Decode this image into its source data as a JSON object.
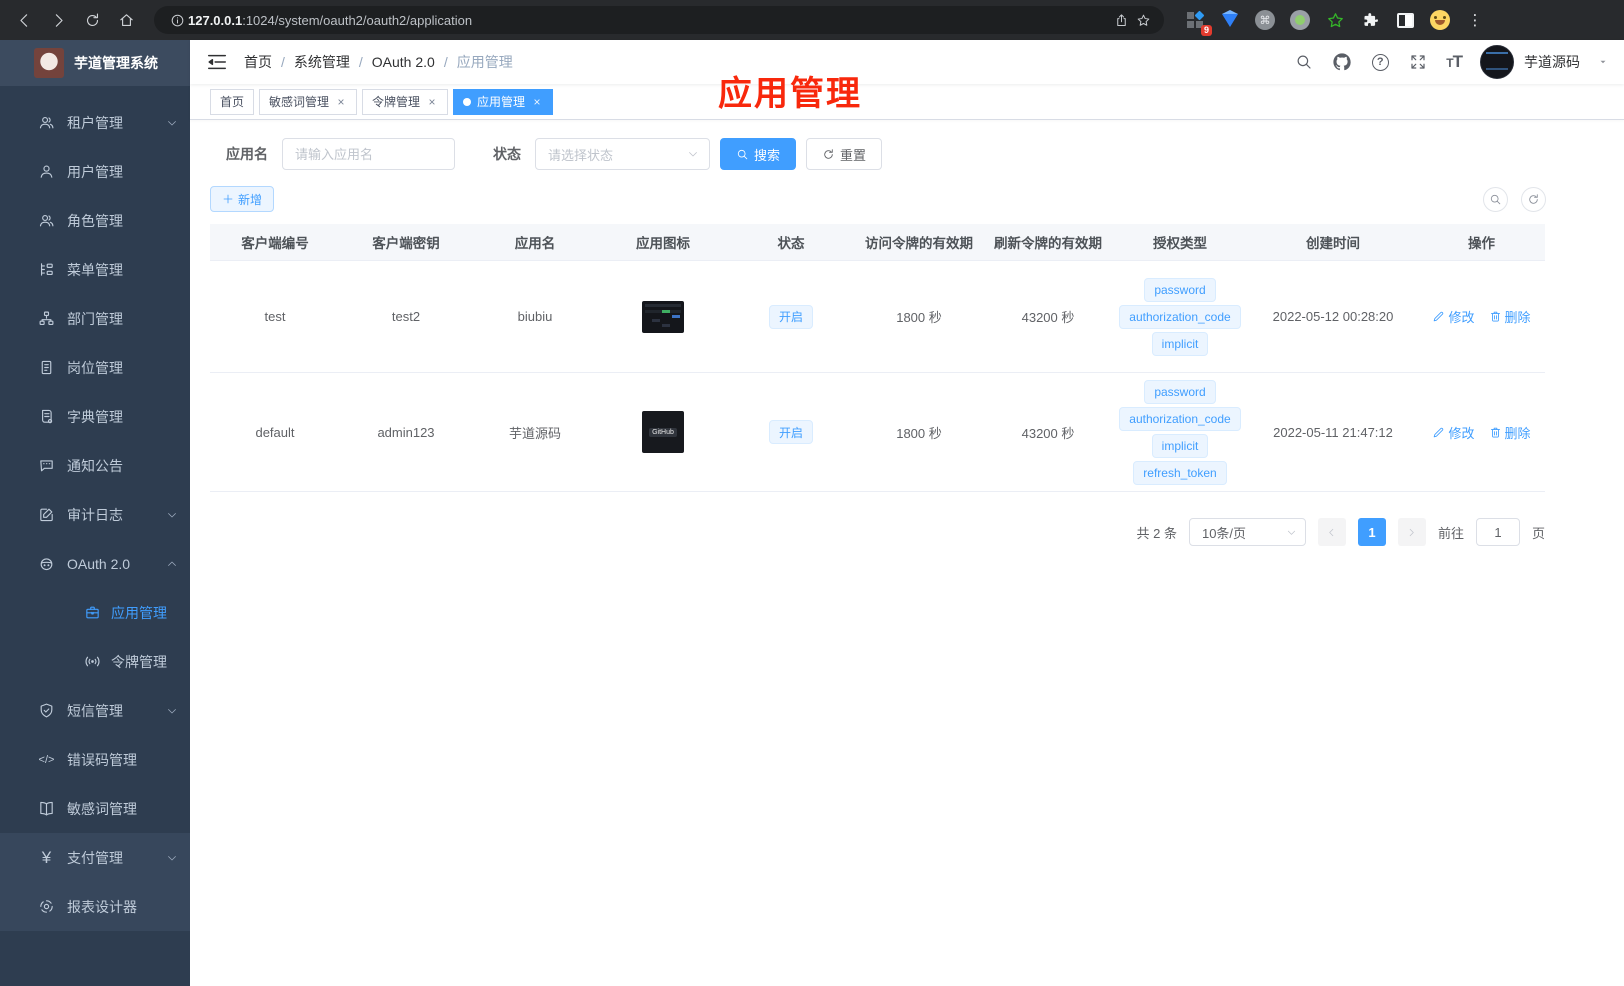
{
  "browser": {
    "url_host": "127.0.0.1",
    "url_path": ":1024/system/oauth2/oauth2/application",
    "ext_badge": "9"
  },
  "glyphs": {
    "question": "?",
    "kebab": "⋮",
    "command": "⌘",
    "yen": "¥",
    "code": "</>",
    "t_small": "T",
    "t_big": "T"
  },
  "sidebar": {
    "title": "芋道管理系统",
    "items": [
      "租户管理",
      "用户管理",
      "角色管理",
      "菜单管理",
      "部门管理",
      "岗位管理",
      "字典管理",
      "通知公告",
      "审计日志",
      "OAuth 2.0",
      "短信管理",
      "错误码管理",
      "敏感词管理",
      "支付管理",
      "报表设计器"
    ],
    "oauth_children": [
      "应用管理",
      "令牌管理"
    ]
  },
  "header": {
    "crumbs": [
      "首页",
      "系统管理",
      "OAuth 2.0",
      "应用管理"
    ],
    "username": "芋道源码"
  },
  "tabs": [
    {
      "label": "首页"
    },
    {
      "label": "敏感词管理"
    },
    {
      "label": "令牌管理"
    },
    {
      "label": "应用管理"
    }
  ],
  "annotation": "应用管理",
  "filters": {
    "name_label": "应用名",
    "name_placeholder": "请输入应用名",
    "status_label": "状态",
    "status_placeholder": "请选择状态",
    "search": "搜索",
    "reset": "重置",
    "add": "新增"
  },
  "table": {
    "headers": [
      "客户端编号",
      "客户端密钥",
      "应用名",
      "应用图标",
      "状态",
      "访问令牌的有效期",
      "刷新令牌的有效期",
      "授权类型",
      "创建时间",
      "操作"
    ],
    "actions": {
      "edit": "修改",
      "delete": "删除"
    },
    "rows": [
      {
        "client_id": "test",
        "client_secret": "test2",
        "app_name": "biubiu",
        "status": "开启",
        "access_ttl": "1800 秒",
        "refresh_ttl": "43200 秒",
        "grants": [
          "password",
          "authorization_code",
          "implicit"
        ],
        "created_at": "2022-05-12 00:28:20"
      },
      {
        "client_id": "default",
        "client_secret": "admin123",
        "app_name": "芋道源码",
        "icon_label": "GitHub",
        "status": "开启",
        "access_ttl": "1800 秒",
        "refresh_ttl": "43200 秒",
        "grants": [
          "password",
          "authorization_code",
          "implicit",
          "refresh_token"
        ],
        "created_at": "2022-05-11 21:47:12"
      }
    ]
  },
  "pagination": {
    "total": "共 2 条",
    "size": "10条/页",
    "page": "1",
    "goto": "前往",
    "goto_value": "1",
    "unit": "页"
  }
}
